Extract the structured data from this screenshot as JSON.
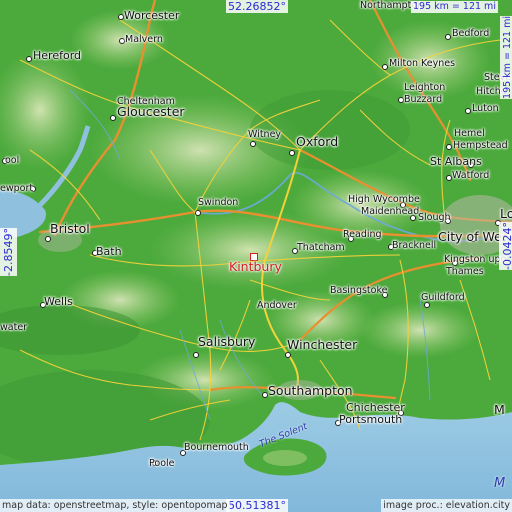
{
  "map": {
    "target": {
      "name": "Kintbury"
    },
    "bounds": {
      "north": "52.26852°",
      "south": "50.51381°",
      "west": "-2.8549°",
      "east": "-0.0424°"
    },
    "scale": {
      "horizontal": "195 km = 121 mi",
      "vertical": "195 km = 121 mi"
    },
    "attribution": {
      "data": "map data: openstreetmap, style: opentopomap",
      "processing": "image proc.: elevation.city"
    },
    "cities": [
      {
        "id": "worcester",
        "name": "Worcester"
      },
      {
        "id": "northampton",
        "name": "Northampton"
      },
      {
        "id": "malvern",
        "name": "Malvern"
      },
      {
        "id": "hereford",
        "name": "Hereford"
      },
      {
        "id": "bedford",
        "name": "Bedford"
      },
      {
        "id": "milton-keynes",
        "name": "Milton Keynes"
      },
      {
        "id": "cheltenham",
        "name": "Cheltenham"
      },
      {
        "id": "gloucester",
        "name": "Gloucester"
      },
      {
        "id": "leighton-buzzard-1",
        "name": "Leighton"
      },
      {
        "id": "leighton-buzzard-2",
        "name": "Buzzard"
      },
      {
        "id": "luton",
        "name": "Luton"
      },
      {
        "id": "stevenage",
        "name": "Steve"
      },
      {
        "id": "hitchin",
        "name": "Hitche"
      },
      {
        "id": "witney",
        "name": "Witney"
      },
      {
        "id": "oxford",
        "name": "Oxford"
      },
      {
        "id": "hemel-1",
        "name": "Hemel"
      },
      {
        "id": "hemel-2",
        "name": "Hempstead"
      },
      {
        "id": "st-albans",
        "name": "St Albans"
      },
      {
        "id": "watford",
        "name": "Watford"
      },
      {
        "id": "newport",
        "name": "ewport"
      },
      {
        "id": "pool",
        "name": "ool"
      },
      {
        "id": "swindon",
        "name": "Swindon"
      },
      {
        "id": "high-wycombe",
        "name": "High Wycombe"
      },
      {
        "id": "maidenhead",
        "name": "Maidenhead"
      },
      {
        "id": "slough",
        "name": "Slough"
      },
      {
        "id": "london",
        "name": "Lo"
      },
      {
        "id": "bristol",
        "name": "Bristol"
      },
      {
        "id": "thatcham",
        "name": "Thatcham"
      },
      {
        "id": "reading",
        "name": "Reading"
      },
      {
        "id": "bracknell",
        "name": "Bracknell"
      },
      {
        "id": "city-of-we",
        "name": "City of We"
      },
      {
        "id": "bath",
        "name": "Bath"
      },
      {
        "id": "kingston",
        "name": "Kingston upo"
      },
      {
        "id": "thames",
        "name": "Thames"
      },
      {
        "id": "basingstoke",
        "name": "Basingstoke"
      },
      {
        "id": "andover",
        "name": "Andover"
      },
      {
        "id": "wells",
        "name": "Wells"
      },
      {
        "id": "guildford",
        "name": "Guildford"
      },
      {
        "id": "water",
        "name": "water"
      },
      {
        "id": "salisbury",
        "name": "Salisbury"
      },
      {
        "id": "winchester",
        "name": "Winchester"
      },
      {
        "id": "southampton",
        "name": "Southampton"
      },
      {
        "id": "chichester",
        "name": "Chichester"
      },
      {
        "id": "portsmouth",
        "name": "Portsmouth"
      },
      {
        "id": "m-east",
        "name": "M"
      },
      {
        "id": "bournemouth",
        "name": "Bournemouth"
      },
      {
        "id": "poole",
        "name": "Poole"
      }
    ],
    "water_labels": [
      {
        "id": "solent",
        "name": "The Solent"
      },
      {
        "id": "channel",
        "name": "M"
      }
    ],
    "colors": {
      "land_low": "#4aa83a",
      "land_high": "#c9dfa2",
      "sea": "#8fc1df",
      "road_major": "#f2d23a",
      "road_motorway": "#e89030",
      "target": "#d42020",
      "coord_text": "#2a2ad0"
    }
  }
}
